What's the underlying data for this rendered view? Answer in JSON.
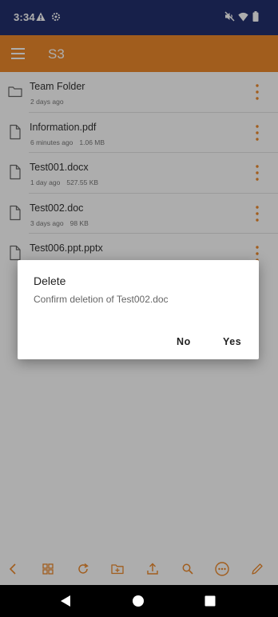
{
  "status_bar": {
    "time": "3:34"
  },
  "app_bar": {
    "title": "S3"
  },
  "files": [
    {
      "name": "Team Folder",
      "modified": "2 days ago",
      "size": "",
      "type": "folder"
    },
    {
      "name": "Information.pdf",
      "modified": "6 minutes ago",
      "size": "1.06 MB",
      "type": "file"
    },
    {
      "name": "Test001.docx",
      "modified": "1 day ago",
      "size": "527.55 KB",
      "type": "file"
    },
    {
      "name": "Test002.doc",
      "modified": "3 days ago",
      "size": "98 KB",
      "type": "file"
    },
    {
      "name": "Test006.ppt.pptx",
      "modified": "",
      "size": "",
      "type": "file"
    }
  ],
  "dialog": {
    "title": "Delete",
    "message": "Confirm deletion of Test002.doc",
    "no_label": "No",
    "yes_label": "Yes"
  },
  "toolbar_icons": [
    "back-icon",
    "grid-view-icon",
    "refresh-icon",
    "new-folder-icon",
    "upload-icon",
    "search-icon",
    "more-icon",
    "edit-icon"
  ],
  "colors": {
    "status_bar": "#22306d",
    "app_bar": "#ee8a2c",
    "accent": "#ee8a2c"
  }
}
